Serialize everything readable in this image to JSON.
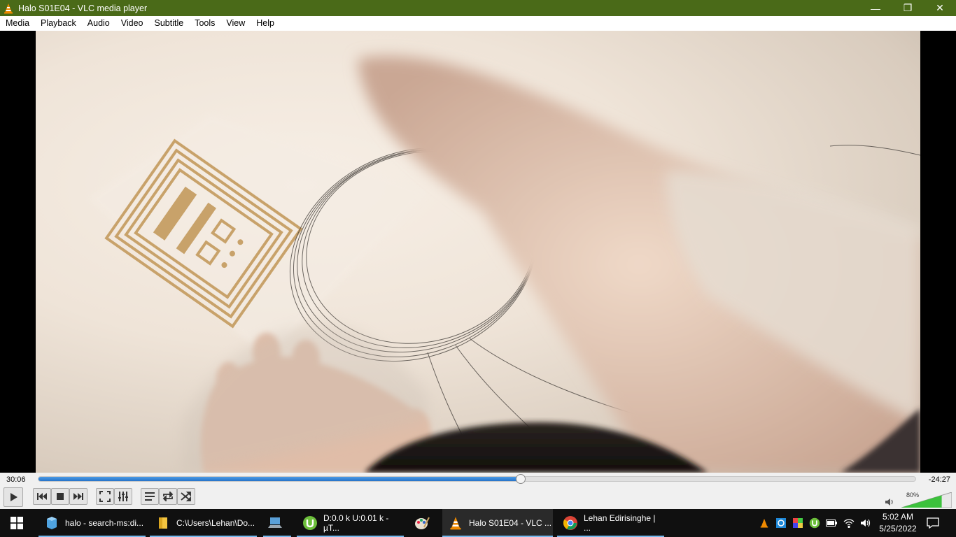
{
  "window": {
    "title": "Halo S01E04 - VLC media player",
    "titlebar_color": "#4a6a18",
    "controls": {
      "minimize": "—",
      "maximize": "❐",
      "close": "✕"
    }
  },
  "menu": [
    "Media",
    "Playback",
    "Audio",
    "Video",
    "Subtitle",
    "Tools",
    "View",
    "Help"
  ],
  "player": {
    "elapsed": "30:06",
    "remaining": "-24:27",
    "progress_fraction": 0.55,
    "accent": "#2f80d6",
    "volume_label": "80%",
    "volume_fraction": 0.8
  },
  "buttons": {
    "play": "play-icon",
    "previous": "previous-icon",
    "stop": "stop-icon",
    "next": "next-icon",
    "fullscreen": "fullscreen-icon",
    "extended_settings": "equalizer-icon",
    "playlist": "playlist-icon",
    "loop": "loop-icon",
    "shuffle": "shuffle-icon"
  },
  "taskbar": {
    "tasks": [
      {
        "label": "halo - search-ms:di...",
        "icon": "search-folder-icon"
      },
      {
        "label": "C:\\Users\\Lehan\\Do...",
        "icon": "file-explorer-icon"
      },
      {
        "label": "",
        "icon": "computer-icon"
      },
      {
        "label": "D:0.0 k U:0.01 k - µT...",
        "icon": "utorrent-icon"
      },
      {
        "label": "",
        "icon": "paint-icon"
      },
      {
        "label": "Halo S01E04 - VLC ...",
        "icon": "vlc-icon"
      },
      {
        "label": "Lehan Edirisinghe | ...",
        "icon": "chrome-icon"
      }
    ],
    "clock_time": "5:02 AM",
    "clock_date": "5/25/2022"
  }
}
